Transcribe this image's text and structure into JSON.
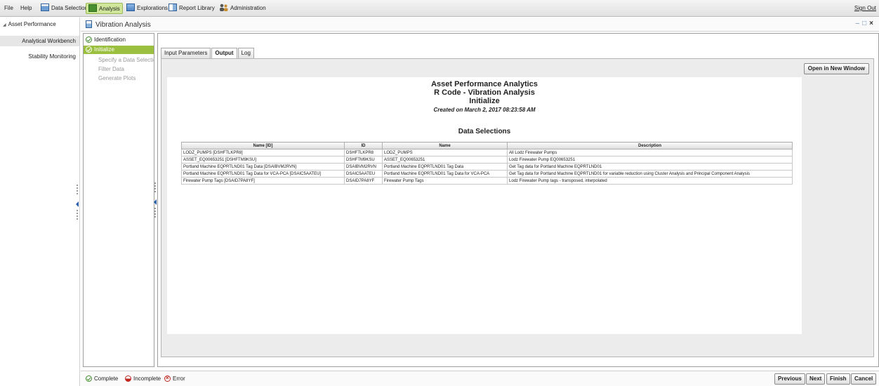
{
  "menu": {
    "file": "File",
    "help": "Help",
    "data_selection": "Data Selection",
    "analysis": "Analysis",
    "explorations": "Explorations",
    "report_library": "Report Library",
    "administration": "Administration",
    "sign_out": "Sign Out"
  },
  "nav": {
    "root": "Asset Performance",
    "items": [
      "Analytical Workbench",
      "Stability Monitoring"
    ]
  },
  "window": {
    "title": "Vibration Analysis",
    "minimize": "–",
    "restore": "□",
    "close": "×"
  },
  "steps": {
    "completed": [
      "Identification",
      "Initialize"
    ],
    "pending": [
      "Specify a Data Selectio",
      "Filter Data",
      "Generate Plots"
    ]
  },
  "tabs": [
    "Input Parameters",
    "Output",
    "Log"
  ],
  "active_tab": "Output",
  "open_new_window": "Open in New Window",
  "report": {
    "title1": "Asset Performance Analytics",
    "title2": "R Code - Vibration Analysis",
    "title3": "Initialize",
    "created": "Created on March 2, 2017 08:23:58 AM",
    "section": "Data Selections",
    "columns": [
      "Name [ID]",
      "ID",
      "Name",
      "Description"
    ],
    "rows": [
      [
        "LODZ_PUMPS [DSHFTLKPR8]",
        "DSHFTLKPR8",
        "LODZ_PUMPS",
        "All Lodz Firewater Pumps"
      ],
      [
        "ASSET_EQ00653251 [DSHFTM9KSU]",
        "DSHFTM9KSU",
        "ASSET_EQ00653251",
        "Lodz Firewater Pump EQ00653251"
      ],
      [
        "Portland Machine EQPRTLND01 Tag Data [DSAIBVM2RVN]",
        "DSAIBVM2RVN",
        "Portland Machine EQPRTLND01 Tag Data",
        "Get Tag data for Portland Machine EQPRTLND01"
      ],
      [
        "Portland Machine EQPRTLND01 Tag Data for VCA-PCA [DSAIC5AATEU]",
        "DSAIC5AATEU",
        "Portland Machine EQPRTLND01 Tag Data for VCA-PCA",
        "Get Tag data for Portland Machine EQPRTLND01 for variable reduction using Cluster Analysis and Principal Component Analysis"
      ],
      [
        "Firewater Pump Tags [DSAID7PA8YF]",
        "DSAID7PA8YF",
        "Firewater Pump Tags",
        "Lodz Firewater Pump tags - transposed, interpolated"
      ]
    ]
  },
  "legend": {
    "complete": "Complete",
    "incomplete": "Incomplete",
    "error": "Error"
  },
  "buttons": {
    "previous": "Previous",
    "next": "Next",
    "finish": "Finish",
    "cancel": "Cancel"
  },
  "colors": {
    "active_step": "#9bbf3f",
    "analysis_highlight": "#cfe69b",
    "complete_green": "#3f8f2a",
    "error_red": "#c0261f"
  }
}
